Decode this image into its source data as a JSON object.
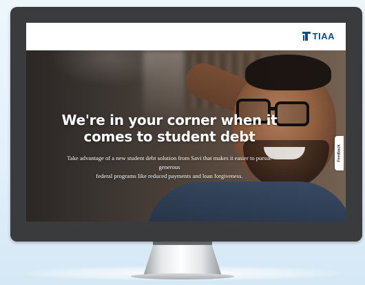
{
  "colors": {
    "tiaa_blue": "#0a4a8c",
    "header_bg": "#ffffff",
    "bezel": "#3a3b3d",
    "hero_text": "#ffffff"
  },
  "header": {
    "logo_icon": "tiaa-logo-mark-icon",
    "logo_text": "TIAA"
  },
  "hero": {
    "title_line1": "We're in your corner when it",
    "title_line2": "comes to student debt",
    "subtitle_line1": "Take advantage of a new student debt solution from Savi that makes it easier to pursue generous",
    "subtitle_line2": "federal programs like reduced payments and loan forgiveness."
  },
  "feedback_tab": {
    "label": "Feedback"
  }
}
